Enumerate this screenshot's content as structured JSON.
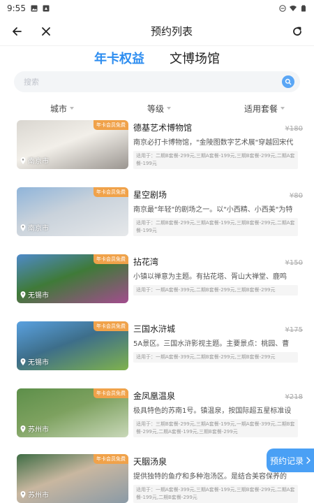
{
  "status": {
    "time": "9:55"
  },
  "nav": {
    "title": "预约列表"
  },
  "tabs": [
    {
      "label": "年卡权益",
      "active": true
    },
    {
      "label": "文博场馆",
      "active": false
    }
  ],
  "search": {
    "placeholder": "搜索"
  },
  "filters": [
    {
      "label": "城市"
    },
    {
      "label": "等级"
    },
    {
      "label": "适用套餐"
    }
  ],
  "items": [
    {
      "name": "德基艺术博物馆",
      "price": "¥180",
      "desc": "南京必打卡博物馆，\"金陵图数字艺术展\"穿越回宋代",
      "packages": "适用于：二期B套餐-299元,三期A套餐-199元,三期B套餐-299元,二期A套餐-199元",
      "city": "南京市",
      "badge": "年卡会员免费",
      "palette": [
        "#d9d6d0",
        "#9a9590",
        "#f2efe9"
      ]
    },
    {
      "name": "星空剧场",
      "price": "¥80",
      "desc": "南京最\"年轻\"的剧场之一。以\"小西精、小西美\"为特",
      "packages": "适用于：二期B套餐-299元,三期A套餐-199元,三期B套餐-299元,二期A套餐-199元",
      "city": "南京市",
      "badge": "年卡会员免费",
      "palette": [
        "#8fb4d9",
        "#e6e8ea",
        "#c9d2db"
      ]
    },
    {
      "name": "拈花湾",
      "price": "¥150",
      "desc": "小镇以禅意为主题。有拈花塔、胥山大禅堂、鹿鸣",
      "packages": "适用于：一期A套餐-399元,二期B套餐-299元,三期B套餐-299元",
      "city": "无锡市",
      "badge": "年卡会员免费",
      "palette": [
        "#4e8ac9",
        "#a34c8e",
        "#3f7a38"
      ]
    },
    {
      "name": "三国水浒城",
      "price": "¥175",
      "desc": "5A景区。三国水浒影视主题。主要景点：桃园、曹",
      "packages": "适用于：一期A套餐-399元,二期B套餐-299元,三期B套餐-299元",
      "city": "无锡市",
      "badge": "年卡会员免费",
      "palette": [
        "#5aa1e0",
        "#7fb24d",
        "#3d6e8a"
      ]
    },
    {
      "name": "金凤凰温泉",
      "price": "¥218",
      "desc": "极具特色的苏南1号。镇温泉，按国际超五星标准设",
      "packages": "适用于：三期B套餐-299元,三期A套餐-199元,一期A套餐-399元,二期B套餐-299元,二期A套餐-199元,三期B套餐-299元",
      "city": "苏州市",
      "badge": "年卡会员免费",
      "palette": [
        "#5d8f4a",
        "#c9d8b9",
        "#7da15f"
      ]
    },
    {
      "name": "天胭汤泉",
      "price": "",
      "desc": "提供独特的鱼疗和多种泡汤区。是结合美容保养的",
      "packages": "适用于：一期A套餐-399元,三期A套餐-199元,三期B套餐-299元,二期A套餐-199元,二期B套餐-299元",
      "city": "苏州市",
      "badge": "年卡会员免费",
      "palette": [
        "#3f6d45",
        "#8a9aa6",
        "#c9b7a0"
      ]
    }
  ],
  "float_button": {
    "label": "预约记录"
  }
}
